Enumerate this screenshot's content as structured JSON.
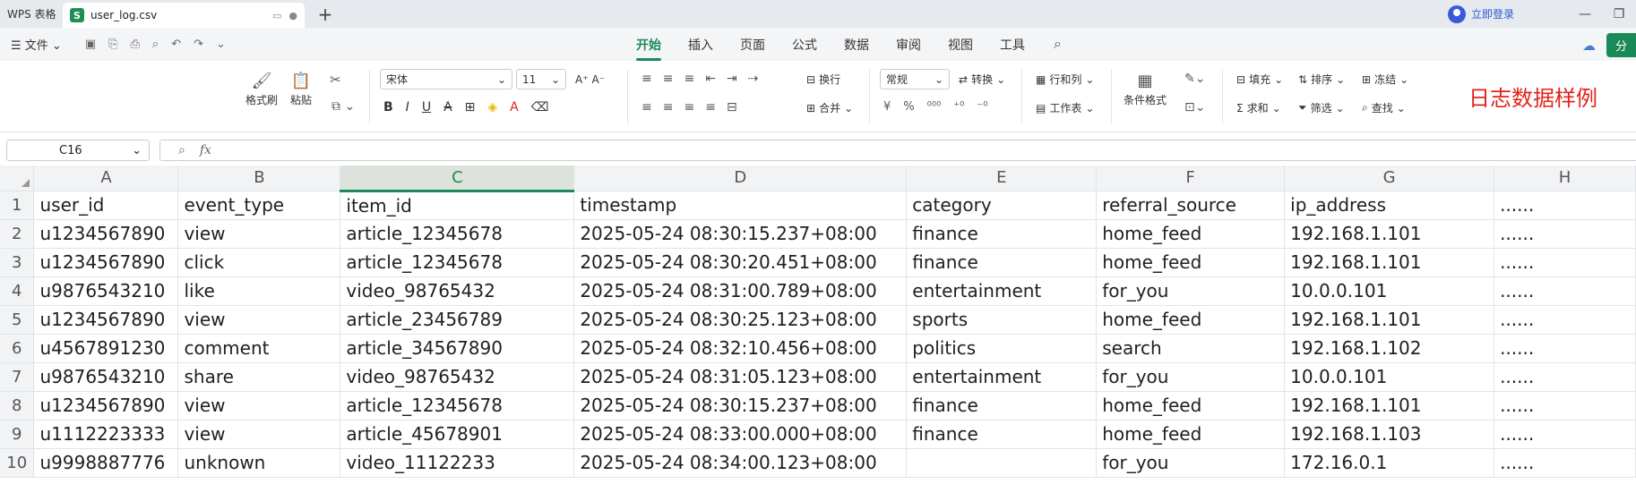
{
  "titlebar": {
    "app_name": "WPS 表格",
    "doc_tab": "user_log.csv",
    "doc_icon": "S",
    "new_tab": "+",
    "login": "立即登录"
  },
  "menubar": {
    "file_menu": "☰ 文件 ⌄",
    "tabs": [
      "开始",
      "插入",
      "页面",
      "公式",
      "数据",
      "审阅",
      "视图",
      "工具"
    ],
    "active_tab": "开始",
    "share": "分"
  },
  "ribbon": {
    "format_painter": "格式刷",
    "paste": "粘贴",
    "font_name": "宋体",
    "font_size": "11",
    "wrap": "换行",
    "merge": "合并",
    "number_format": "常规",
    "convert": "转换",
    "rows_cols": "行和列",
    "worksheet": "工作表",
    "cond_format": "条件格式",
    "fill": "填充",
    "sort": "排序",
    "freeze": "冻结",
    "sum": "求和",
    "filter": "筛选",
    "find": "查找",
    "annotation": "日志数据样例"
  },
  "formula_bar": {
    "cell_ref": "C16",
    "fx": "fx",
    "content": ""
  },
  "sheet": {
    "columns": [
      "A",
      "B",
      "C",
      "D",
      "E",
      "F",
      "G",
      "H"
    ],
    "selected_column": "C",
    "rows": [
      [
        "1",
        "user_id",
        "event_type",
        "item_id",
        "timestamp",
        "category",
        "referral_source",
        "ip_address",
        "......"
      ],
      [
        "2",
        "u1234567890",
        "view",
        "article_12345678",
        "2025-05-24 08:30:15.237+08:00",
        "finance",
        "home_feed",
        "192.168.1.101",
        "......"
      ],
      [
        "3",
        "u1234567890",
        "click",
        "article_12345678",
        "2025-05-24 08:30:20.451+08:00",
        "finance",
        "home_feed",
        "192.168.1.101",
        "......"
      ],
      [
        "4",
        "u9876543210",
        "like",
        "video_98765432",
        "2025-05-24 08:31:00.789+08:00",
        "entertainment",
        "for_you",
        "10.0.0.101",
        "......"
      ],
      [
        "5",
        "u1234567890",
        "view",
        "article_23456789",
        "2025-05-24 08:30:25.123+08:00",
        "sports",
        "home_feed",
        "192.168.1.101",
        "......"
      ],
      [
        "6",
        "u4567891230",
        "comment",
        "article_34567890",
        "2025-05-24 08:32:10.456+08:00",
        "politics",
        "search",
        "192.168.1.102",
        "......"
      ],
      [
        "7",
        "u9876543210",
        "share",
        "video_98765432",
        "2025-05-24 08:31:05.123+08:00",
        "entertainment",
        "for_you",
        "10.0.0.101",
        "......"
      ],
      [
        "8",
        "u1234567890",
        "view",
        "article_12345678",
        "2025-05-24 08:30:15.237+08:00",
        "finance",
        "home_feed",
        "192.168.1.101",
        "......"
      ],
      [
        "9",
        "u1112223333",
        "view",
        "article_45678901",
        "2025-05-24 08:33:00.000+08:00",
        "finance",
        "home_feed",
        "192.168.1.103",
        "......"
      ],
      [
        "10",
        "u9998887776",
        "unknown",
        "video_11122233",
        "2025-05-24 08:34:00.123+08:00",
        "",
        "for_you",
        "172.16.0.1",
        "......"
      ]
    ]
  },
  "colors": {
    "accent": "#1a8a59",
    "annotation": "#e0241b"
  }
}
